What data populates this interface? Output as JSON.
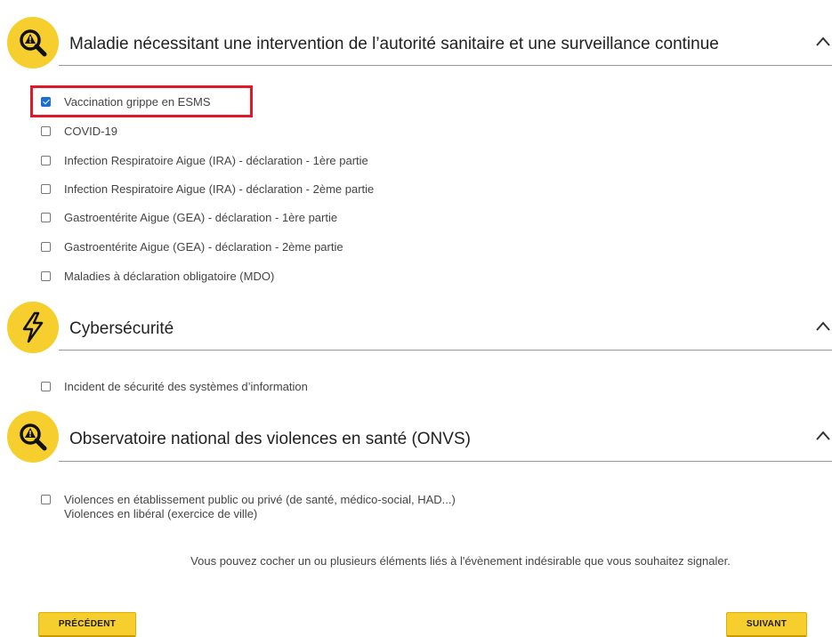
{
  "sections": [
    {
      "title": "Maladie nécessitant une intervention de l’autorité sanitaire et une surveillance continue",
      "icon": "magnifier-alert-icon",
      "items": [
        {
          "label": "Vaccination grippe en ESMS",
          "checked": true
        },
        {
          "label": "COVID-19",
          "checked": false
        },
        {
          "label": "Infection Respiratoire Aigue (IRA) - déclaration - 1ère partie",
          "checked": false
        },
        {
          "label": "Infection Respiratoire Aigue (IRA) - déclaration - 2ème partie",
          "checked": false
        },
        {
          "label": "Gastroentérite Aigue (GEA) - déclaration - 1ère partie",
          "checked": false
        },
        {
          "label": "Gastroentérite Aigue (GEA) - déclaration - 2ème partie",
          "checked": false
        },
        {
          "label": "Maladies à déclaration obligatoire (MDO)",
          "checked": false
        }
      ]
    },
    {
      "title": "Cybersécurité",
      "icon": "lightning-icon",
      "items": [
        {
          "label": "Incident de sécurité des systèmes d’information",
          "checked": false
        }
      ]
    },
    {
      "title": "Observatoire national des violences en santé (ONVS)",
      "icon": "magnifier-alert-icon",
      "items": [
        {
          "label": "Violences en établissement public ou privé (de santé, médico-social, HAD...)",
          "label2": "Violences en libéral (exercice de ville)",
          "checked": false
        }
      ]
    }
  ],
  "hint": "Vous pouvez cocher un ou plusieurs éléments liés à l'évènement indésirable que vous souhaitez signaler.",
  "buttons": {
    "previous": "PRÉCÉDENT",
    "next": "SUIVANT"
  },
  "colors": {
    "accent": "#f6cf2e",
    "highlight": "#e0192a",
    "checkbox": "#1a6fd6"
  }
}
